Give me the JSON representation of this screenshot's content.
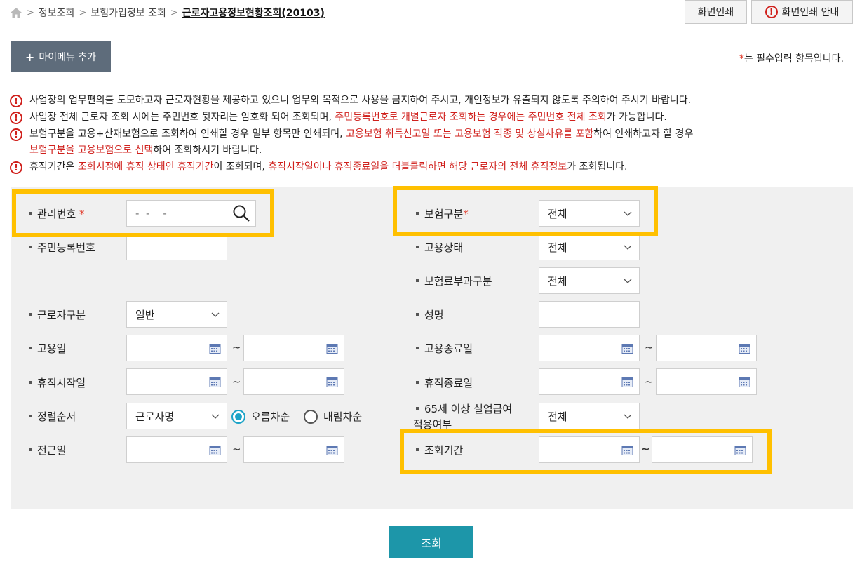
{
  "breadcrumb": {
    "items": [
      "정보조회",
      "보험가입정보 조회"
    ],
    "current": "근로자고용정보현황조회(20103)"
  },
  "top_buttons": {
    "print": "화면인쇄",
    "print_guide": "화면인쇄 안내"
  },
  "mymenu": {
    "plus": "+",
    "label": "마이메뉴 추가"
  },
  "required_note": {
    "star": "*",
    "text": "는 필수입력 항목입니다."
  },
  "notices": {
    "n1": "사업장의 업무편의를 도모하고자 근로자현황을 제공하고 있으니 업무외 목적으로 사용을 금지하여 주시고, 개인정보가 유출되지 않도록 주의하여 주시기 바랍니다.",
    "n2_a": "사업장 전체 근로자 조회 시에는 주민번호 뒷자리는 암호화 되어 조회되며, ",
    "n2_b": "주민등록번호로 개별근로자 조회하는 경우에는 주민번호 전체 조회",
    "n2_c": "가 가능합니다.",
    "n3_a": "보험구분을 고용+산재보험으로 조회하여 인쇄할 경우 일부 항목만 인쇄되며, ",
    "n3_b": "고용보험 취득신고일 또는 고용보험 직종 및 상실사유를 포함",
    "n3_c": "하여 인쇄하고자 할 경우",
    "n3_d": "보험구분을 고용보험으로 선택",
    "n3_e": "하여 조회하시기 바랍니다.",
    "n4_a": "휴직기간은 ",
    "n4_b": "조회시점에 휴직 상태인 휴직기간",
    "n4_c": "이 조회되며, ",
    "n4_d": "휴직시작일이나 휴직종료일을 더블클릭하면 해당 근로자의 전체 휴직정보",
    "n4_e": "가 조회됩니다."
  },
  "form": {
    "mgmt_no": {
      "label": "관리번호",
      "star": "*",
      "value": "-  -    -"
    },
    "resident_no": {
      "label": "주민등록번호",
      "value": ""
    },
    "worker_type": {
      "label": "근로자구분",
      "selected": "일반"
    },
    "hire_date": {
      "label": "고용일",
      "from": "",
      "to": ""
    },
    "leave_start": {
      "label": "휴직시작일",
      "from": "",
      "to": ""
    },
    "sort_order": {
      "label": "정렬순서",
      "selected": "근로자명",
      "asc": "오름차순",
      "desc": "내림차순",
      "asc_checked": true
    },
    "transfer_date": {
      "label": "전근일",
      "from": "",
      "to": ""
    },
    "insurance_type": {
      "label": "보험구분",
      "star": "*",
      "selected": "전체"
    },
    "employment_status": {
      "label": "고용상태",
      "selected": "전체"
    },
    "premium_type": {
      "label": "보험료부과구분",
      "selected": "전체"
    },
    "name": {
      "label": "성명",
      "value": ""
    },
    "hire_end_date": {
      "label": "고용종료일",
      "from": "",
      "to": ""
    },
    "leave_end": {
      "label": "휴직종료일",
      "from": "",
      "to": ""
    },
    "over65": {
      "label_line1": "65세 이상 실업급여",
      "label_line2": "적용여부",
      "selected": "전체"
    },
    "query_period": {
      "label": "조회기간",
      "from": "",
      "to": ""
    },
    "tilde": "~"
  },
  "query_button": "조회",
  "colors": {
    "highlight": "#ffc000",
    "query_button": "#1d96a9",
    "mymenu": "#5e6c7b",
    "warning": "#d0201c",
    "radio_on": "#1ba3c7"
  }
}
